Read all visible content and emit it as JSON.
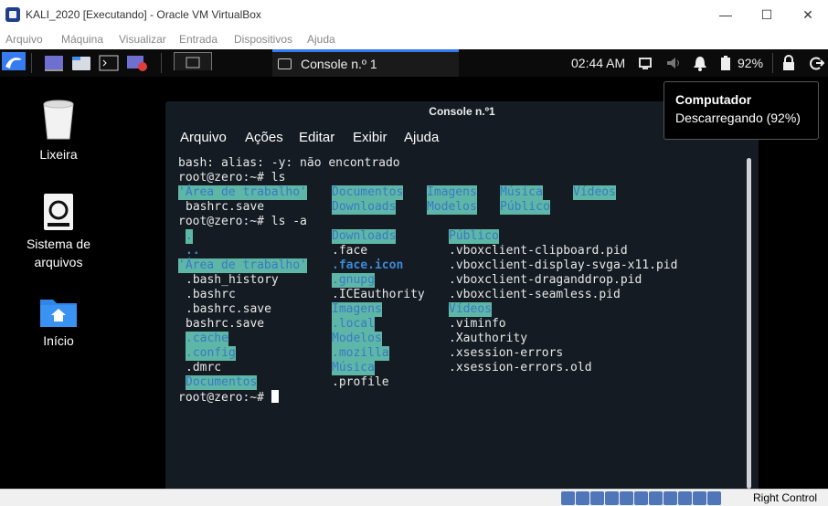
{
  "vbox": {
    "title": "KALI_2020 [Executando] - Oracle VM VirtualBox",
    "menu": [
      "Arquivo",
      "Máquina",
      "Visualizar",
      "Entrada",
      "Dispositivos",
      "Ajuda"
    ],
    "host_key": "Right Control"
  },
  "panel": {
    "task_title": "Console n.º 1",
    "clock": "02:44 AM",
    "battery": "92%"
  },
  "desktop": {
    "icons": [
      {
        "label": "Lixeira",
        "icon": "trash-icon"
      },
      {
        "label": "Sistema de arquivos",
        "icon": "drive-icon"
      },
      {
        "label": "Início",
        "icon": "home-folder-icon"
      }
    ]
  },
  "tooltip": {
    "title": "Computador",
    "subtitle": "Descarregando (92%)"
  },
  "terminal": {
    "title": "Console n.º1",
    "menu": [
      "Arquivo",
      "Ações",
      "Editar",
      "Exibir",
      "Ajuda"
    ],
    "line1": "bash: alias: -y: não encontrado",
    "prompt1": "root@zero:~# ls",
    "ls": {
      "row1": [
        "'Área de trabalho'",
        "Documentos",
        "Imagens",
        "Música",
        "Vídeos"
      ],
      "row2": [
        "bashrc.save",
        "Downloads",
        "Modelos",
        "Público"
      ]
    },
    "prompt2": "root@zero:~# ls -a",
    "la": {
      "col1": [
        ".",
        "..",
        "'Área de trabalho'",
        ".bash_history",
        ".bashrc",
        ".bashrc.save",
        "bashrc.save",
        ".cache",
        ".config",
        ".dmrc",
        "Documentos"
      ],
      "col2": [
        "Downloads",
        ".face",
        ".face.icon",
        ".gnupg",
        ".ICEauthority",
        "Imagens",
        ".local",
        "Modelos",
        ".mozilla",
        "Música",
        ".profile"
      ],
      "col3": [
        "Público",
        ".vboxclient-clipboard.pid",
        ".vboxclient-display-svga-x11.pid",
        ".vboxclient-draganddrop.pid",
        ".vboxclient-seamless.pid",
        "Vídeos",
        ".viminfo",
        ".Xauthority",
        ".xsession-errors",
        ".xsession-errors.old"
      ]
    },
    "prompt3": "root@zero:~# "
  }
}
